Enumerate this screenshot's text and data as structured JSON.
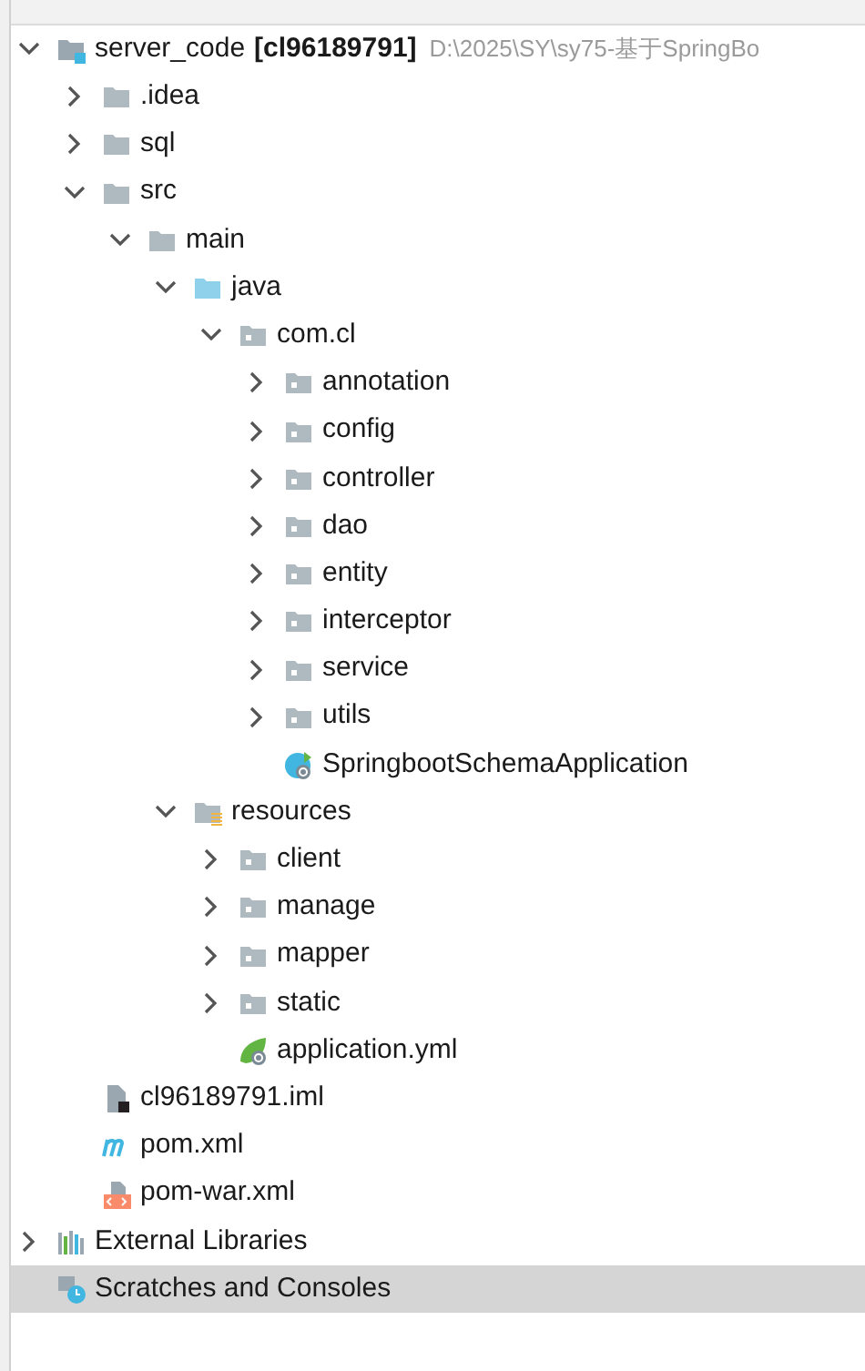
{
  "tree": [
    {
      "kind": "module",
      "name": "server_code",
      "module": "[cl96189791]",
      "path": "D:\\2025\\SY\\sy75-基于SpringBo",
      "expanded": true,
      "selected": false,
      "children": [
        {
          "kind": "folder",
          "name": ".idea",
          "expanded": false,
          "selected": false
        },
        {
          "kind": "folder",
          "name": "sql",
          "expanded": false,
          "selected": false
        },
        {
          "kind": "folder",
          "name": "src",
          "expanded": true,
          "selected": false,
          "children": [
            {
              "kind": "folder",
              "name": "main",
              "expanded": true,
              "selected": false,
              "children": [
                {
                  "kind": "source-folder",
                  "name": "java",
                  "expanded": true,
                  "selected": false,
                  "children": [
                    {
                      "kind": "package",
                      "name": "com.cl",
                      "expanded": true,
                      "selected": false,
                      "children": [
                        {
                          "kind": "package",
                          "name": "annotation",
                          "expanded": false,
                          "selected": false
                        },
                        {
                          "kind": "package",
                          "name": "config",
                          "expanded": false,
                          "selected": false
                        },
                        {
                          "kind": "package",
                          "name": "controller",
                          "expanded": false,
                          "selected": false
                        },
                        {
                          "kind": "package",
                          "name": "dao",
                          "expanded": false,
                          "selected": false
                        },
                        {
                          "kind": "package",
                          "name": "entity",
                          "expanded": false,
                          "selected": false
                        },
                        {
                          "kind": "package",
                          "name": "interceptor",
                          "expanded": false,
                          "selected": false
                        },
                        {
                          "kind": "package",
                          "name": "service",
                          "expanded": false,
                          "selected": false
                        },
                        {
                          "kind": "package",
                          "name": "utils",
                          "expanded": false,
                          "selected": false
                        },
                        {
                          "kind": "spring-class",
                          "name": "SpringbootSchemaApplication",
                          "selected": false
                        }
                      ]
                    }
                  ]
                },
                {
                  "kind": "resources-folder",
                  "name": "resources",
                  "expanded": true,
                  "selected": false,
                  "children": [
                    {
                      "kind": "package",
                      "name": "client",
                      "expanded": false,
                      "selected": false
                    },
                    {
                      "kind": "package",
                      "name": "manage",
                      "expanded": false,
                      "selected": false
                    },
                    {
                      "kind": "package",
                      "name": "mapper",
                      "expanded": false,
                      "selected": false
                    },
                    {
                      "kind": "package",
                      "name": "static",
                      "expanded": false,
                      "selected": false
                    },
                    {
                      "kind": "spring-config",
                      "name": "application.yml",
                      "selected": false
                    }
                  ]
                }
              ]
            }
          ]
        },
        {
          "kind": "iml",
          "name": "cl96189791.iml",
          "selected": false
        },
        {
          "kind": "maven",
          "name": "pom.xml",
          "selected": false
        },
        {
          "kind": "xml",
          "name": "pom-war.xml",
          "selected": false
        }
      ]
    },
    {
      "kind": "libraries",
      "name": "External Libraries",
      "expanded": false,
      "selected": false
    },
    {
      "kind": "scratches",
      "name": "Scratches and Consoles",
      "selected": true
    }
  ]
}
